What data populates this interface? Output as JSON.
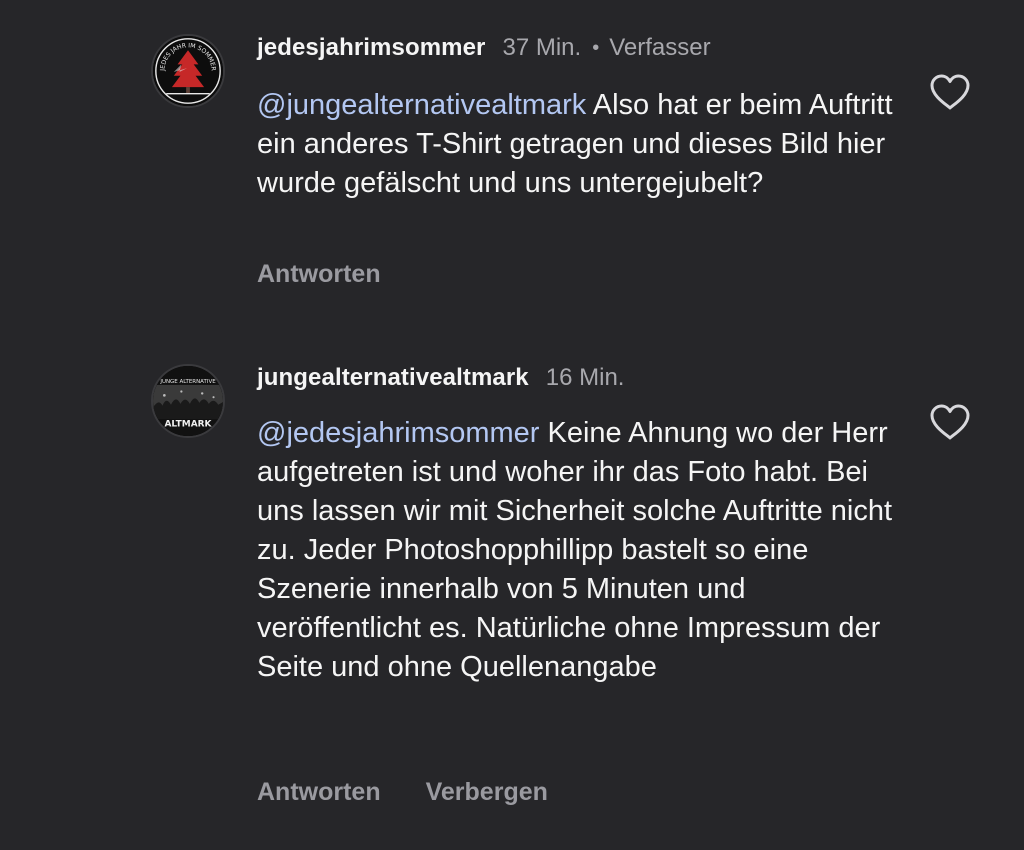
{
  "comments": [
    {
      "username": "jedesjahrimsommer",
      "time": "37 Min.",
      "separator": "•",
      "author_tag": "Verfasser",
      "mention": "@jungealternativealtmark",
      "text": " Also hat er beim Auftritt ein anderes T-Shirt getragen und dieses Bild hier wurde gefälscht und uns untergejubelt?",
      "avatar_icon": "tree-logo-icon",
      "avatar_text": "JEDES JAHR IM SOMMER",
      "actions": {
        "reply": "Antworten"
      },
      "like_icon": "heart-outline-icon"
    },
    {
      "username": "jungealternativealtmark",
      "time": "16 Min.",
      "mention": "@jedesjahrimsommer",
      "text": " Keine Ahnung wo der Herr aufgetreten ist und woher ihr das Foto habt. Bei uns lassen wir mit Sicherheit solche Auftritte nicht zu. Jeder Photoshopphillipp bastelt so eine Szenerie innerhalb von 5 Minuten und veröffentlicht es. Natürliche ohne Impressum der Seite und ohne Quellenangabe",
      "avatar_icon": "crowd-logo-icon",
      "avatar_text_top": "JUNGE ALTERNATIVE",
      "avatar_text_bottom": "ALTMARK",
      "actions": {
        "reply": "Antworten",
        "hide": "Verbergen"
      },
      "like_icon": "heart-outline-icon"
    }
  ],
  "colors": {
    "background": "#262629",
    "text": "#f5f5f5",
    "muted": "#a8a8ad",
    "mention": "#b3c7f2",
    "accent_red": "#c62828"
  }
}
